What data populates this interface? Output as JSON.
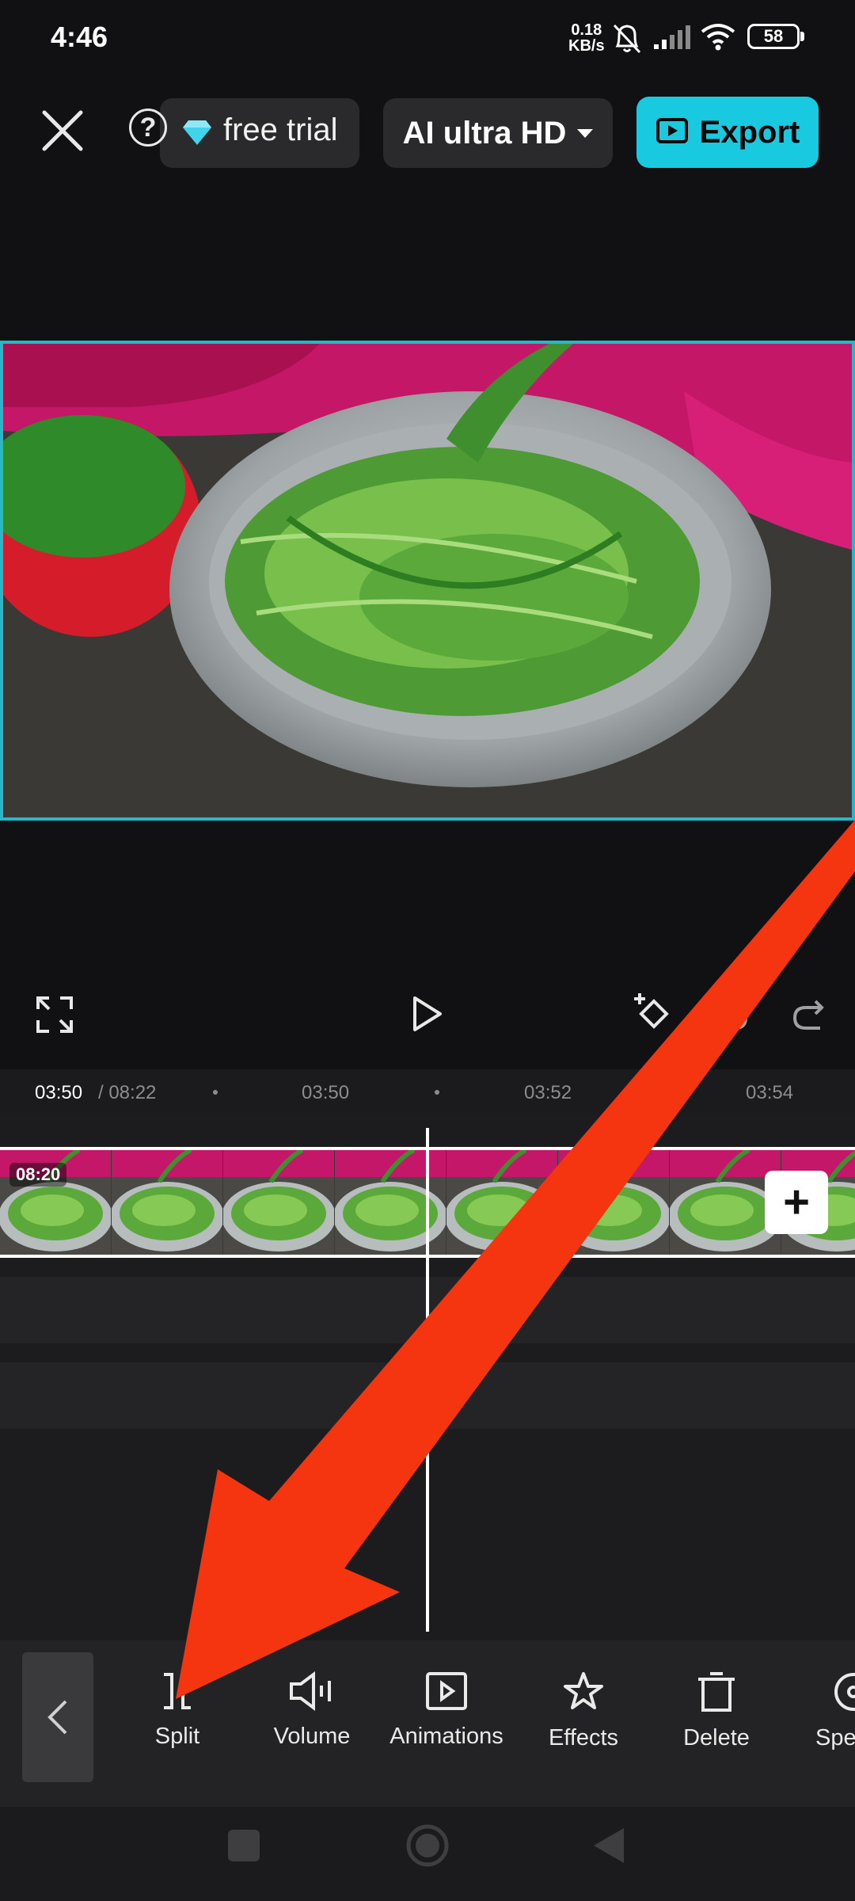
{
  "status_bar": {
    "time": "4:46",
    "net_speed_value": "0.18",
    "net_speed_unit": "KB/s",
    "battery": "58",
    "icons": [
      "bell-muted-icon",
      "signal-icon",
      "wifi-icon",
      "battery-icon"
    ]
  },
  "top_bar": {
    "close_icon": "close-icon",
    "help_glyph": "?",
    "trial_label": "free trial",
    "quality_label": "AI ultra HD",
    "export_label": "Export"
  },
  "playback": {
    "icons": [
      "fullscreen-icon",
      "play-icon",
      "keyframe-icon",
      "undo-icon",
      "redo-icon"
    ]
  },
  "ruler": {
    "current_time": "03:50",
    "total_time": " / 08:22",
    "ticks": [
      "03:50",
      "03:52",
      "03:54"
    ]
  },
  "timeline": {
    "clip_duration": "08:20",
    "add_clip_glyph": "+"
  },
  "toolbar": {
    "tools": [
      {
        "label": "Split",
        "icon": "split-icon"
      },
      {
        "label": "Volume",
        "icon": "volume-icon"
      },
      {
        "label": "Animations",
        "icon": "animations-icon"
      },
      {
        "label": "Effects",
        "icon": "effects-icon"
      },
      {
        "label": "Delete",
        "icon": "delete-icon"
      },
      {
        "label": "Spe",
        "icon": "speed-icon"
      }
    ]
  },
  "colors": {
    "accent": "#18c9e0",
    "preview_border": "#28b7c9",
    "annotation_arrow": "#f4350f"
  }
}
